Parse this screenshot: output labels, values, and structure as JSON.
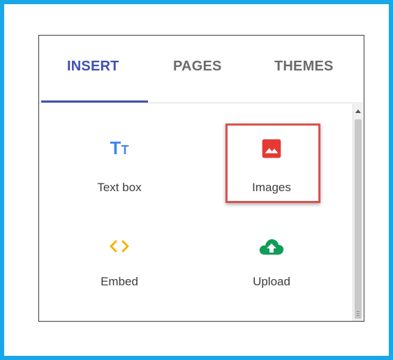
{
  "tabs": [
    {
      "label": "INSERT",
      "active": true
    },
    {
      "label": "PAGES",
      "active": false
    },
    {
      "label": "THEMES",
      "active": false
    }
  ],
  "items": {
    "textbox": {
      "label": "Text box",
      "icon": "text-box-icon"
    },
    "images": {
      "label": "Images",
      "icon": "image-icon"
    },
    "embed": {
      "label": "Embed",
      "icon": "embed-code-icon"
    },
    "upload": {
      "label": "Upload",
      "icon": "cloud-upload-icon"
    }
  },
  "textbox_glyph": {
    "big": "T",
    "small": "T"
  },
  "embed_glyph": "< >",
  "colors": {
    "frame": "#1aa7e8",
    "active_tab": "#3f51b5",
    "textbox_icon": "#4285f4",
    "images_icon": "#e53935",
    "embed_icon": "#f4b400",
    "upload_icon": "#0f9d58",
    "highlight": "#d9534f"
  }
}
